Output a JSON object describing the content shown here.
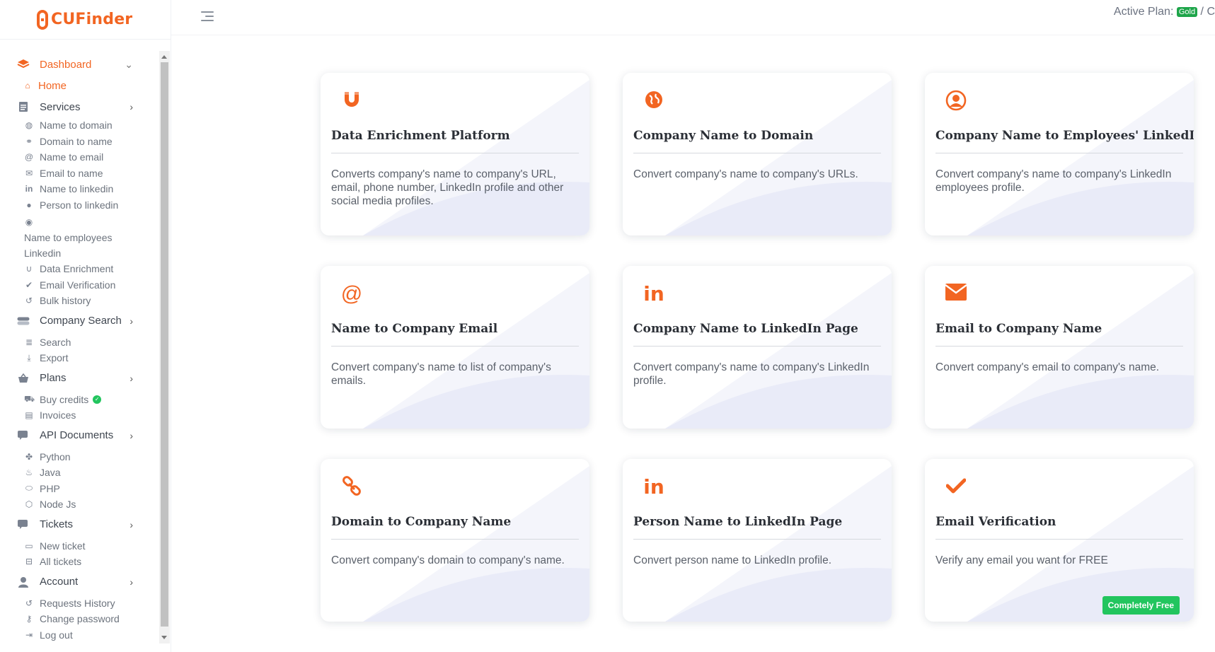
{
  "app": {
    "name": "CUFinder"
  },
  "header": {
    "active_plan_label": "Active Plan:",
    "plan_badge": "Gold",
    "plan_suffix": "/ C"
  },
  "sidebar": {
    "dashboard": "Dashboard",
    "home": "Home",
    "services": "Services",
    "services_items": [
      "Name to domain",
      "Domain to name",
      "Name to email",
      "Email to name",
      "Name to linkedin",
      "Person to linkedin",
      "Name to employees Linkedin",
      "Data Enrichment",
      "Email Verification",
      "Bulk history"
    ],
    "company_search": "Company Search",
    "company_search_items": [
      "Search",
      "Export"
    ],
    "plans": "Plans",
    "plans_items": [
      "Buy credits",
      "Invoices"
    ],
    "api_documents": "API Documents",
    "api_items": [
      "Python",
      "Java",
      "PHP",
      "Node Js"
    ],
    "tickets": "Tickets",
    "tickets_items": [
      "New ticket",
      "All tickets"
    ],
    "account": "Account",
    "account_items": [
      "Requests History",
      "Change password",
      "Log out"
    ]
  },
  "cards": [
    {
      "title": "Data Enrichment Platform",
      "desc": "Converts company's name to company's URL, email, phone number, LinkedIn profile and other social media profiles.",
      "icon": "magnet-icon"
    },
    {
      "title": "Company Name to Domain",
      "desc": "Convert company's name to company's URLs.",
      "icon": "globe-icon"
    },
    {
      "title": "Company Name to Employees' LinkedIn",
      "desc": "Convert company's name to company's LinkedIn employees profile.",
      "icon": "user-circle-icon"
    },
    {
      "title": "Name to Company Email",
      "desc": "Convert company's name to list of company's emails.",
      "icon": "at-icon"
    },
    {
      "title": "Company Name to LinkedIn Page",
      "desc": "Convert company's name to company's LinkedIn profile.",
      "icon": "linkedin-icon"
    },
    {
      "title": "Email to Company Name",
      "desc": "Convert company's email to company's name.",
      "icon": "envelope-icon"
    },
    {
      "title": "Domain to Company Name",
      "desc": "Convert company's domain to company's name.",
      "icon": "link-icon"
    },
    {
      "title": "Person Name to LinkedIn Page",
      "desc": "Convert person name to LinkedIn profile.",
      "icon": "linkedin-icon"
    },
    {
      "title": "Email Verification",
      "desc": "Verify any email you want for FREE",
      "icon": "check-icon",
      "badge": "Completely Free"
    }
  ],
  "colors": {
    "accent": "#f26522",
    "success": "#22c55e",
    "plan_badge": "#1ea54a"
  }
}
